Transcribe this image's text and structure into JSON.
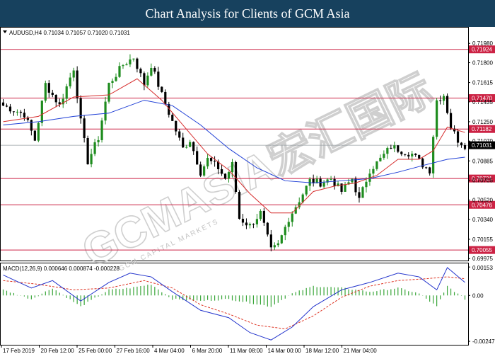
{
  "header": {
    "title": "Chart Analysis for Clients of GCM Asia"
  },
  "watermark": {
    "text": "GCMASIA宏汇国际",
    "subtext": "GCM CAPITAL MARKETS"
  },
  "colors": {
    "header_bg": "#17415e",
    "bull": "#1e8c1e",
    "bear": "#000000",
    "ma_fast": "#d62d2d",
    "ma_slow": "#1f3fd6",
    "level_line": "#cc2244",
    "level_label_bg": "#cc2244",
    "price_label_bg": "#000000",
    "macd_hist": "#3aa63a",
    "macd_line": "#2233cc",
    "macd_signal": "#dd3322"
  },
  "chart_data": [
    {
      "type": "candlestick",
      "symbol_info": "AUDUSD,H4  0.71034 0.71057 0.71020 0.71031",
      "y_ticks": [
        "0.71980",
        "0.71924",
        "0.71800",
        "0.71615",
        "0.71470",
        "0.71435",
        "0.71250",
        "0.71182",
        "0.71070",
        "0.71031",
        "0.70885",
        "0.70721",
        "0.70705",
        "0.70520",
        "0.70476",
        "0.70340",
        "0.70155",
        "0.70055",
        "0.69975"
      ],
      "ylim": [
        0.6997,
        0.7212
      ],
      "levels": [
        {
          "value": 0.71924,
          "label": "0.71924"
        },
        {
          "value": 0.7147,
          "label": "0.71470"
        },
        {
          "value": 0.71182,
          "label": "0.71182"
        },
        {
          "value": 0.70721,
          "label": "0.70721"
        },
        {
          "value": 0.70476,
          "label": "0.70476"
        },
        {
          "value": 0.70055,
          "label": "0.70055"
        }
      ],
      "current_price": {
        "value": 0.71031,
        "label": "0.71031"
      },
      "x_labels": [
        "17 Feb 2019",
        "20 Feb 12:00",
        "25 Feb 00:00",
        "27 Feb 16:00",
        "4 Mar 04:00",
        "6 Mar 20:00",
        "11 Mar 08:00",
        "14 Mar 00:00",
        "18 Mar 12:00",
        "21 Mar 04:00"
      ],
      "path": [
        {
          "i": 0,
          "v": 0.714
        },
        {
          "i": 6,
          "v": 0.7132
        },
        {
          "i": 9,
          "v": 0.7108
        },
        {
          "i": 12,
          "v": 0.716
        },
        {
          "i": 16,
          "v": 0.714
        },
        {
          "i": 20,
          "v": 0.7175
        },
        {
          "i": 22,
          "v": 0.7125
        },
        {
          "i": 24,
          "v": 0.7088
        },
        {
          "i": 27,
          "v": 0.711
        },
        {
          "i": 30,
          "v": 0.716
        },
        {
          "i": 34,
          "v": 0.7178
        },
        {
          "i": 37,
          "v": 0.7185
        },
        {
          "i": 40,
          "v": 0.716
        },
        {
          "i": 42,
          "v": 0.7178
        },
        {
          "i": 45,
          "v": 0.715
        },
        {
          "i": 48,
          "v": 0.7125
        },
        {
          "i": 51,
          "v": 0.71
        },
        {
          "i": 53,
          "v": 0.7108
        },
        {
          "i": 56,
          "v": 0.7078
        },
        {
          "i": 58,
          "v": 0.709
        },
        {
          "i": 61,
          "v": 0.7082
        },
        {
          "i": 63,
          "v": 0.7072
        },
        {
          "i": 65,
          "v": 0.7085
        },
        {
          "i": 67,
          "v": 0.7035
        },
        {
          "i": 70,
          "v": 0.7028
        },
        {
          "i": 73,
          "v": 0.704
        },
        {
          "i": 76,
          "v": 0.7005
        },
        {
          "i": 78,
          "v": 0.701
        },
        {
          "i": 81,
          "v": 0.7035
        },
        {
          "i": 84,
          "v": 0.7052
        },
        {
          "i": 87,
          "v": 0.707
        },
        {
          "i": 90,
          "v": 0.7068
        },
        {
          "i": 93,
          "v": 0.7072
        },
        {
          "i": 96,
          "v": 0.706
        },
        {
          "i": 99,
          "v": 0.7072
        },
        {
          "i": 101,
          "v": 0.7052
        },
        {
          "i": 104,
          "v": 0.708
        },
        {
          "i": 107,
          "v": 0.709
        },
        {
          "i": 110,
          "v": 0.7102
        },
        {
          "i": 113,
          "v": 0.7098
        },
        {
          "i": 116,
          "v": 0.7095
        },
        {
          "i": 119,
          "v": 0.7085
        },
        {
          "i": 121,
          "v": 0.708
        },
        {
          "i": 123,
          "v": 0.7145
        },
        {
          "i": 125,
          "v": 0.715
        },
        {
          "i": 127,
          "v": 0.712
        },
        {
          "i": 129,
          "v": 0.7108
        },
        {
          "i": 131,
          "v": 0.7103
        }
      ],
      "ma_fast": [
        {
          "i": 0,
          "v": 0.7125
        },
        {
          "i": 10,
          "v": 0.713
        },
        {
          "i": 20,
          "v": 0.7148
        },
        {
          "i": 30,
          "v": 0.715
        },
        {
          "i": 38,
          "v": 0.7165
        },
        {
          "i": 45,
          "v": 0.7145
        },
        {
          "i": 52,
          "v": 0.7118
        },
        {
          "i": 58,
          "v": 0.7095
        },
        {
          "i": 64,
          "v": 0.708
        },
        {
          "i": 70,
          "v": 0.7058
        },
        {
          "i": 76,
          "v": 0.704
        },
        {
          "i": 82,
          "v": 0.704
        },
        {
          "i": 88,
          "v": 0.706
        },
        {
          "i": 94,
          "v": 0.7065
        },
        {
          "i": 100,
          "v": 0.7068
        },
        {
          "i": 106,
          "v": 0.7075
        },
        {
          "i": 112,
          "v": 0.709
        },
        {
          "i": 118,
          "v": 0.709
        },
        {
          "i": 122,
          "v": 0.7098
        },
        {
          "i": 126,
          "v": 0.712
        },
        {
          "i": 131,
          "v": 0.7115
        }
      ],
      "ma_slow": [
        {
          "i": 0,
          "v": 0.7122
        },
        {
          "i": 10,
          "v": 0.7125
        },
        {
          "i": 20,
          "v": 0.713
        },
        {
          "i": 30,
          "v": 0.7133
        },
        {
          "i": 40,
          "v": 0.7145
        },
        {
          "i": 48,
          "v": 0.714
        },
        {
          "i": 56,
          "v": 0.7122
        },
        {
          "i": 64,
          "v": 0.71
        },
        {
          "i": 72,
          "v": 0.7082
        },
        {
          "i": 80,
          "v": 0.707
        },
        {
          "i": 88,
          "v": 0.7068
        },
        {
          "i": 96,
          "v": 0.707
        },
        {
          "i": 104,
          "v": 0.7072
        },
        {
          "i": 112,
          "v": 0.7078
        },
        {
          "i": 120,
          "v": 0.7085
        },
        {
          "i": 126,
          "v": 0.709
        },
        {
          "i": 131,
          "v": 0.7092
        }
      ]
    },
    {
      "type": "macd",
      "info": "MACD(12,26,9) 0.000646 0.000874 -0.000228",
      "y_ticks": [
        "0.00153",
        "0.00",
        "-0.00247"
      ],
      "ylim": [
        -0.00262,
        0.00165
      ],
      "macd_line": [
        {
          "i": 0,
          "v": 0.0011
        },
        {
          "i": 8,
          "v": 0.0004
        },
        {
          "i": 14,
          "v": 0.0008
        },
        {
          "i": 22,
          "v": -0.0003
        },
        {
          "i": 30,
          "v": 0.0007
        },
        {
          "i": 36,
          "v": 0.0012
        },
        {
          "i": 42,
          "v": 0.001
        },
        {
          "i": 48,
          "v": 0.0002
        },
        {
          "i": 56,
          "v": -0.0008
        },
        {
          "i": 64,
          "v": -0.0012
        },
        {
          "i": 70,
          "v": -0.002
        },
        {
          "i": 76,
          "v": -0.0024
        },
        {
          "i": 82,
          "v": -0.0017
        },
        {
          "i": 88,
          "v": -0.0006
        },
        {
          "i": 96,
          "v": 0.0003
        },
        {
          "i": 104,
          "v": 0.0007
        },
        {
          "i": 112,
          "v": 0.0012
        },
        {
          "i": 118,
          "v": 0.001
        },
        {
          "i": 123,
          "v": 0.0003
        },
        {
          "i": 126,
          "v": 0.0015
        },
        {
          "i": 131,
          "v": 0.0007
        }
      ],
      "signal_line": [
        {
          "i": 0,
          "v": 0.0008
        },
        {
          "i": 10,
          "v": 0.0006
        },
        {
          "i": 20,
          "v": 0.0003
        },
        {
          "i": 30,
          "v": 0.0004
        },
        {
          "i": 40,
          "v": 0.0008
        },
        {
          "i": 48,
          "v": 0.0004
        },
        {
          "i": 56,
          "v": -0.0005
        },
        {
          "i": 64,
          "v": -0.001
        },
        {
          "i": 72,
          "v": -0.0016
        },
        {
          "i": 80,
          "v": -0.0018
        },
        {
          "i": 88,
          "v": -0.0011
        },
        {
          "i": 96,
          "v": -0.0001
        },
        {
          "i": 104,
          "v": 0.0005
        },
        {
          "i": 112,
          "v": 0.0008
        },
        {
          "i": 120,
          "v": 0.0009
        },
        {
          "i": 126,
          "v": 0.001
        },
        {
          "i": 131,
          "v": 0.0009
        }
      ],
      "histogram": [
        {
          "i": 0,
          "v": 0.0003
        },
        {
          "i": 8,
          "v": -0.0002
        },
        {
          "i": 14,
          "v": 0.0004
        },
        {
          "i": 22,
          "v": -0.0006
        },
        {
          "i": 30,
          "v": 0.0003
        },
        {
          "i": 36,
          "v": 0.0004
        },
        {
          "i": 42,
          "v": 0.0006
        },
        {
          "i": 48,
          "v": -0.0002
        },
        {
          "i": 56,
          "v": -0.0003
        },
        {
          "i": 64,
          "v": -0.0002
        },
        {
          "i": 70,
          "v": -0.0004
        },
        {
          "i": 76,
          "v": -0.0006
        },
        {
          "i": 82,
          "v": 0.0001
        },
        {
          "i": 88,
          "v": 0.0005
        },
        {
          "i": 96,
          "v": 0.0004
        },
        {
          "i": 104,
          "v": 0.0002
        },
        {
          "i": 112,
          "v": 0.0004
        },
        {
          "i": 118,
          "v": 0.0001
        },
        {
          "i": 123,
          "v": -0.0006
        },
        {
          "i": 126,
          "v": 0.0005
        },
        {
          "i": 131,
          "v": -0.0002
        }
      ]
    }
  ]
}
